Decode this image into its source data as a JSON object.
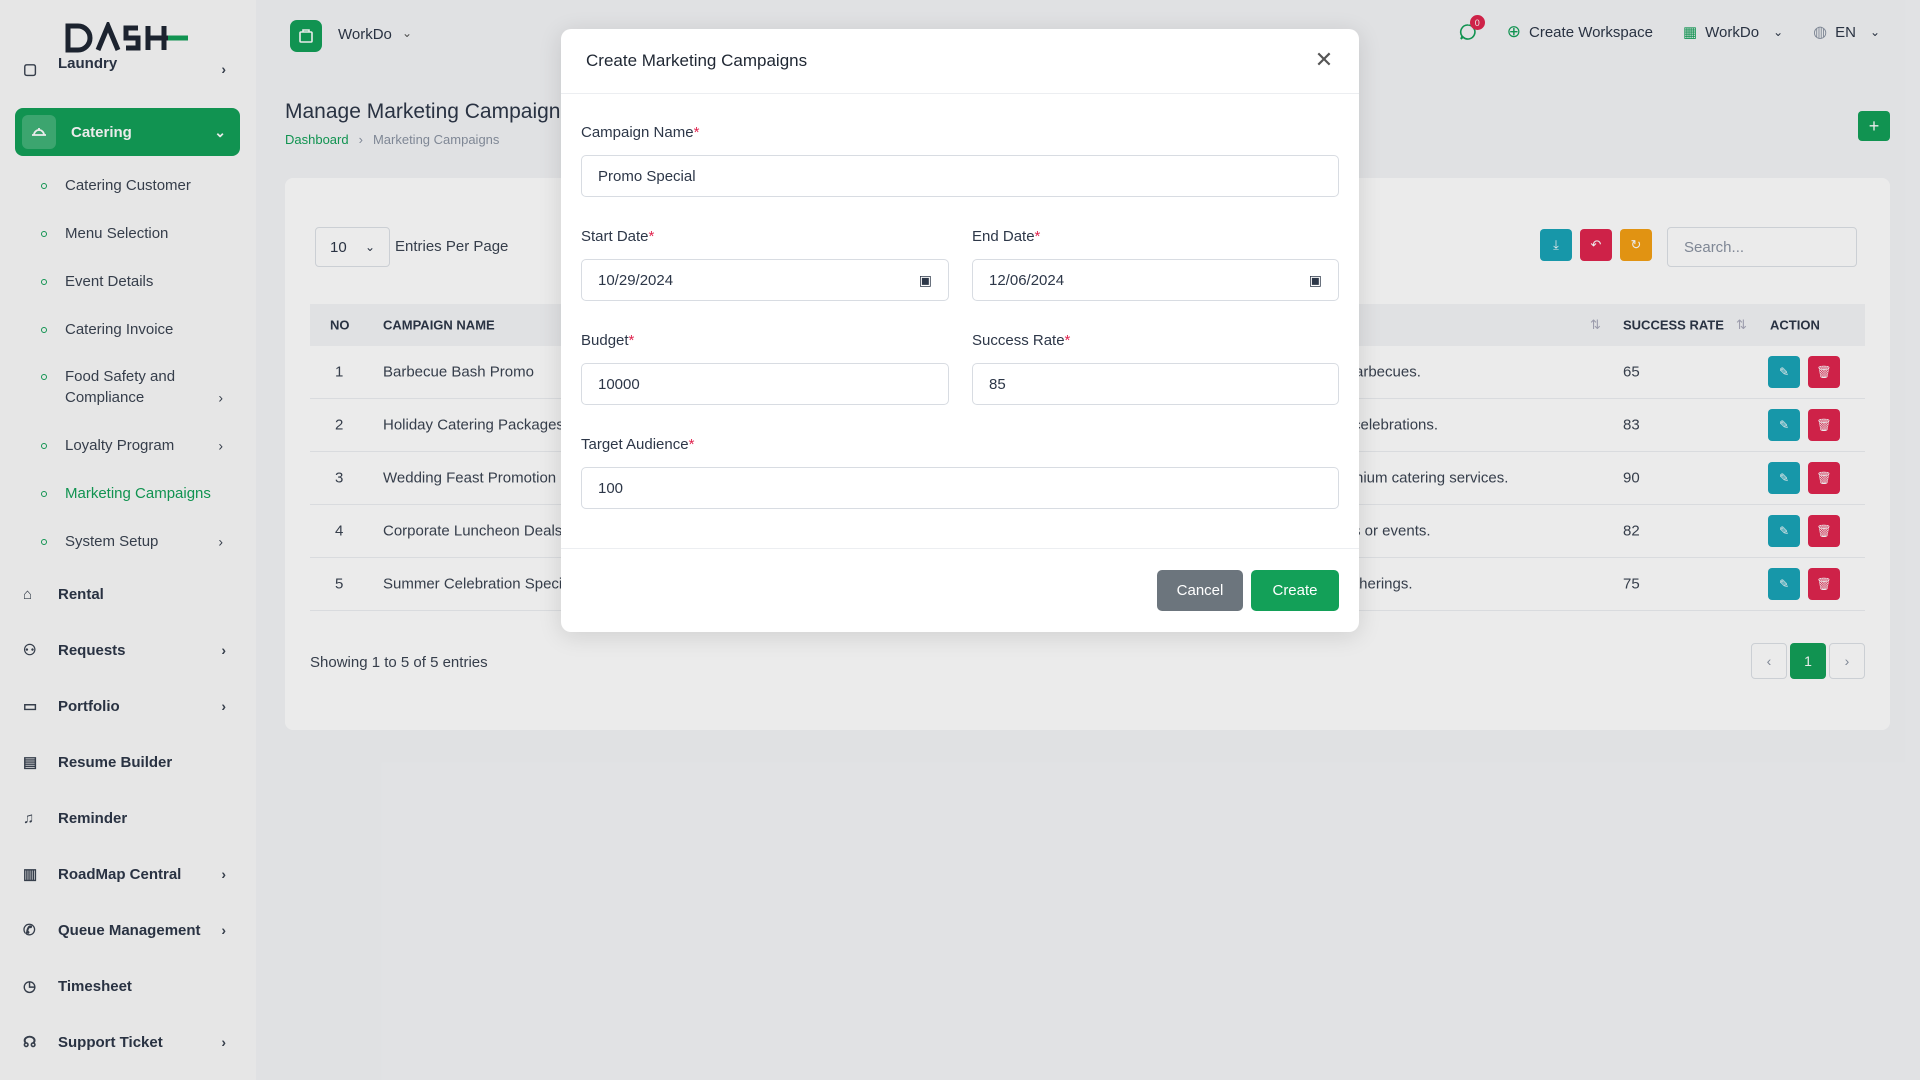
{
  "sidebar": {
    "logo_text": "DASH",
    "partial_item": "Laundry",
    "active_module": "Catering",
    "sub_items": [
      {
        "label": "Catering Customer"
      },
      {
        "label": "Menu Selection"
      },
      {
        "label": "Event Details"
      },
      {
        "label": "Catering Invoice"
      },
      {
        "label": "Food Safety and Compliance"
      },
      {
        "label": "Loyalty Program"
      },
      {
        "label": "Marketing Campaigns"
      },
      {
        "label": "System Setup"
      }
    ],
    "modules": [
      {
        "label": "Rental",
        "icon": "home-icon"
      },
      {
        "label": "Requests",
        "icon": "user-plus-icon"
      },
      {
        "label": "Portfolio",
        "icon": "briefcase-icon"
      },
      {
        "label": "Resume Builder",
        "icon": "file-icon"
      },
      {
        "label": "Reminder",
        "icon": "bell-icon"
      },
      {
        "label": "RoadMap Central",
        "icon": "map-icon"
      },
      {
        "label": "Queue Management",
        "icon": "phone-icon"
      },
      {
        "label": "Timesheet",
        "icon": "clock-icon"
      },
      {
        "label": "Support Ticket",
        "icon": "headset-icon"
      }
    ]
  },
  "topbar": {
    "workspace": "WorkDo",
    "notification_count": "0",
    "create_workspace": "Create Workspace",
    "workspace_menu": "WorkDo",
    "language": "EN"
  },
  "page": {
    "title": "Manage Marketing Campaigns",
    "breadcrumb": [
      "Dashboard",
      "Marketing Campaigns"
    ]
  },
  "table": {
    "entries_value": "10",
    "entries_label": "Entries Per Page",
    "search_placeholder": "Search...",
    "headers": {
      "no": "NO",
      "campaign": "CAMPAIGN NAME",
      "success": "SUCCESS RATE",
      "action": "ACTION"
    },
    "rows": [
      {
        "no": "1",
        "name": "Barbecue Bash Promo",
        "desc": "arbecues.",
        "rate": "65"
      },
      {
        "no": "2",
        "name": "Holiday Catering Packages",
        "desc": "celebrations.",
        "rate": "83"
      },
      {
        "no": "3",
        "name": "Wedding Feast Promotion",
        "desc": "nium catering services.",
        "rate": "90"
      },
      {
        "no": "4",
        "name": "Corporate Luncheon Deals",
        "desc": "s or events.",
        "rate": "82"
      },
      {
        "no": "5",
        "name": "Summer Celebration Speci",
        "desc": "therings.",
        "rate": "75"
      }
    ],
    "showing": "Showing 1 to 5 of 5 entries",
    "current_page": "1"
  },
  "modal": {
    "title": "Create Marketing Campaigns",
    "campaign_name_label": "Campaign Name",
    "campaign_name_value": "Promo Special",
    "start_date_label": "Start Date",
    "start_date_value": "10/29/2024",
    "end_date_label": "End Date",
    "end_date_value": "12/06/2024",
    "budget_label": "Budget",
    "budget_value": "10000",
    "success_rate_label": "Success Rate",
    "success_rate_value": "85",
    "target_audience_label": "Target Audience",
    "target_audience_value": "100",
    "required_mark": "*",
    "cancel_label": "Cancel",
    "create_label": "Create"
  },
  "colors": {
    "brand_green": "#13a058",
    "teal": "#1aa4b8",
    "danger": "#e0254f",
    "warning": "#f5a014",
    "cancel_gray": "#6c757d"
  }
}
